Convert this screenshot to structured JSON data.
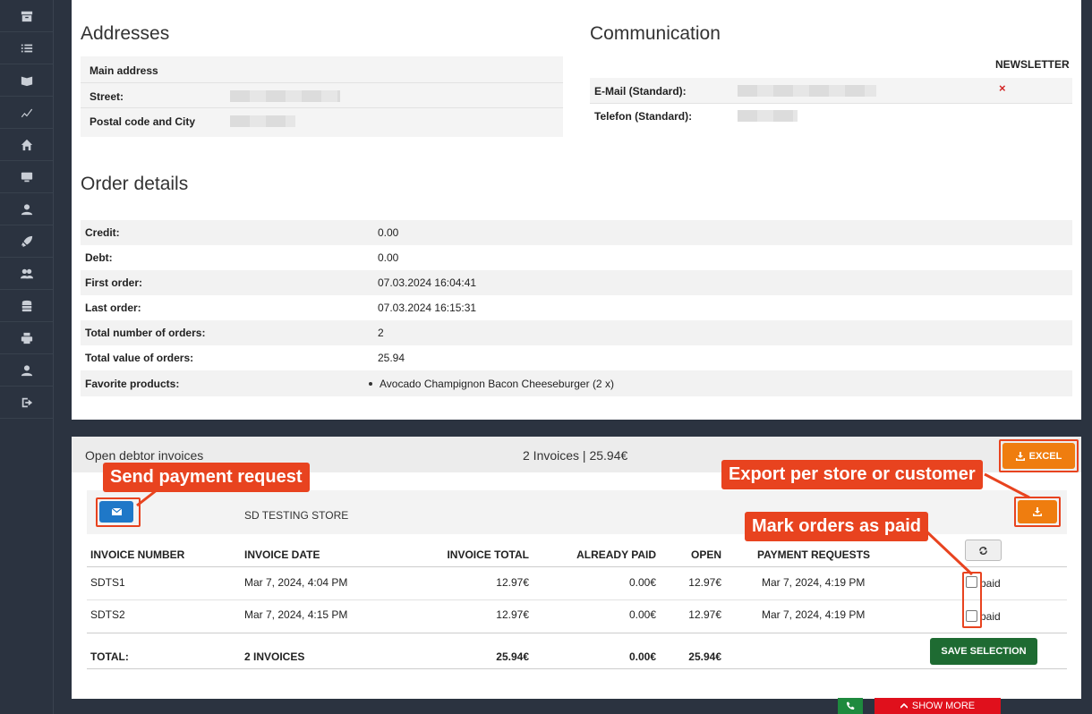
{
  "addresses": {
    "title": "Addresses",
    "main_address": "Main address",
    "street_label": "Street:",
    "postal_label": "Postal code and City"
  },
  "communication": {
    "title": "Communication",
    "newsletter_header": "NEWSLETTER",
    "email_label": "E-Mail (Standard):",
    "phone_label": "Telefon (Standard):",
    "newsletter_status": "×"
  },
  "order_details": {
    "title": "Order details",
    "rows": [
      {
        "label": "Credit:",
        "value": "0.00"
      },
      {
        "label": "Debt:",
        "value": "0.00"
      },
      {
        "label": "First order:",
        "value": "07.03.2024 16:04:41"
      },
      {
        "label": "Last order:",
        "value": "07.03.2024 16:15:31"
      },
      {
        "label": "Total number of orders:",
        "value": "2"
      },
      {
        "label": "Total value of orders:",
        "value": "25.94"
      },
      {
        "label": "Favorite products:",
        "value": "Avocado Champignon Bacon Cheeseburger (2 x)"
      }
    ]
  },
  "invoices": {
    "title": "Open debtor invoices",
    "summary": "2 Invoices | 25.94€",
    "excel_label": "EXCEL",
    "store_name": "SD TESTING STORE",
    "headers": {
      "number": "INVOICE NUMBER",
      "date": "INVOICE DATE",
      "total": "INVOICE TOTAL",
      "paid": "ALREADY PAID",
      "open": "OPEN",
      "requests": "PAYMENT REQUESTS"
    },
    "rows": [
      {
        "number": "SDTS1",
        "date": "Mar 7, 2024, 4:04 PM",
        "total": "12.97€",
        "paid": "0.00€",
        "open": "12.97€",
        "request": "Mar 7, 2024, 4:19 PM",
        "paid_label": "paid"
      },
      {
        "number": "SDTS2",
        "date": "Mar 7, 2024, 4:15 PM",
        "total": "12.97€",
        "paid": "0.00€",
        "open": "12.97€",
        "request": "Mar 7, 2024, 4:19 PM",
        "paid_label": "paid"
      }
    ],
    "footer": {
      "label": "TOTAL:",
      "count": "2 INVOICES",
      "total": "25.94€",
      "paid": "0.00€",
      "open": "25.94€"
    },
    "save_label": "SAVE SELECTION"
  },
  "callouts": {
    "send": "Send payment request",
    "export": "Export per store or customer",
    "mark": "Mark orders as paid"
  },
  "bottom": {
    "show_more": "SHOW MORE"
  },
  "colors": {
    "accent_orange": "#ef7d0f",
    "callout_red": "#e8431f",
    "mail_blue": "#1f78c8",
    "save_green": "#1e6b32",
    "sidebar": "#2b3340"
  }
}
